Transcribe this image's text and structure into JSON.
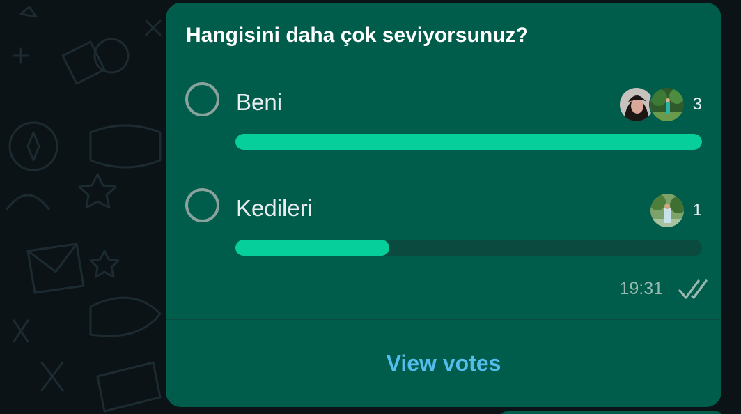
{
  "poll": {
    "question": "Hangisini daha çok seviyorsunuz?",
    "options": [
      {
        "label": "Beni",
        "count": "3",
        "fraction": 1.0,
        "voters": [
          "voter-avatar-1",
          "voter-avatar-2"
        ]
      },
      {
        "label": "Kedileri",
        "count": "1",
        "fraction": 0.33,
        "voters": [
          "voter-avatar-3"
        ]
      }
    ],
    "time": "19:31",
    "status_icon": "double-check-icon",
    "view_votes_label": "View votes"
  },
  "colors": {
    "bubble": "#005c4b",
    "bar_fill": "#06cf9c",
    "bar_track": "#0b4a3e",
    "link": "#53bdeb",
    "background": "#0c1317"
  }
}
